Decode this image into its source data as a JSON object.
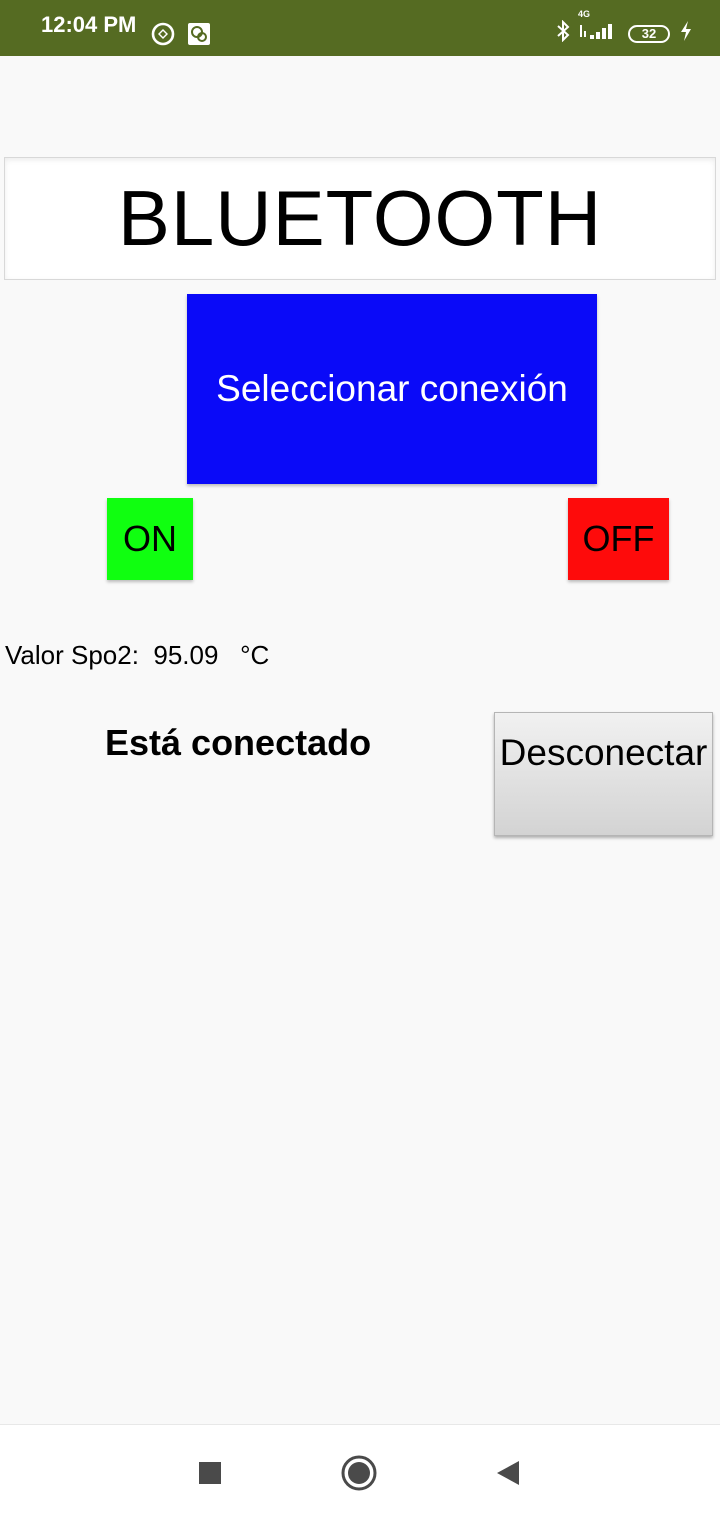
{
  "status_bar": {
    "time": "12:04 PM",
    "network": "4G",
    "battery": "32"
  },
  "title": "BLUETOOTH",
  "select_button": "Seleccionar conexión",
  "on_button": "ON",
  "off_button": "OFF",
  "spo2": {
    "label": "Valor Spo2:",
    "value": "95.09",
    "unit": "°C"
  },
  "status_text": "Está conectado",
  "disconnect_button": "Desconectar",
  "colors": {
    "status_bar": "#556b22",
    "select_button": "#0a0af8",
    "on_button": "#10ff10",
    "off_button": "#fe0b0b"
  },
  "icons": {
    "left": [
      "sync-icon",
      "chat-icon"
    ],
    "right": [
      "bluetooth-icon",
      "signal-icon",
      "battery-icon",
      "charging-icon"
    ],
    "nav": [
      "recents-icon",
      "home-icon",
      "back-icon"
    ]
  }
}
